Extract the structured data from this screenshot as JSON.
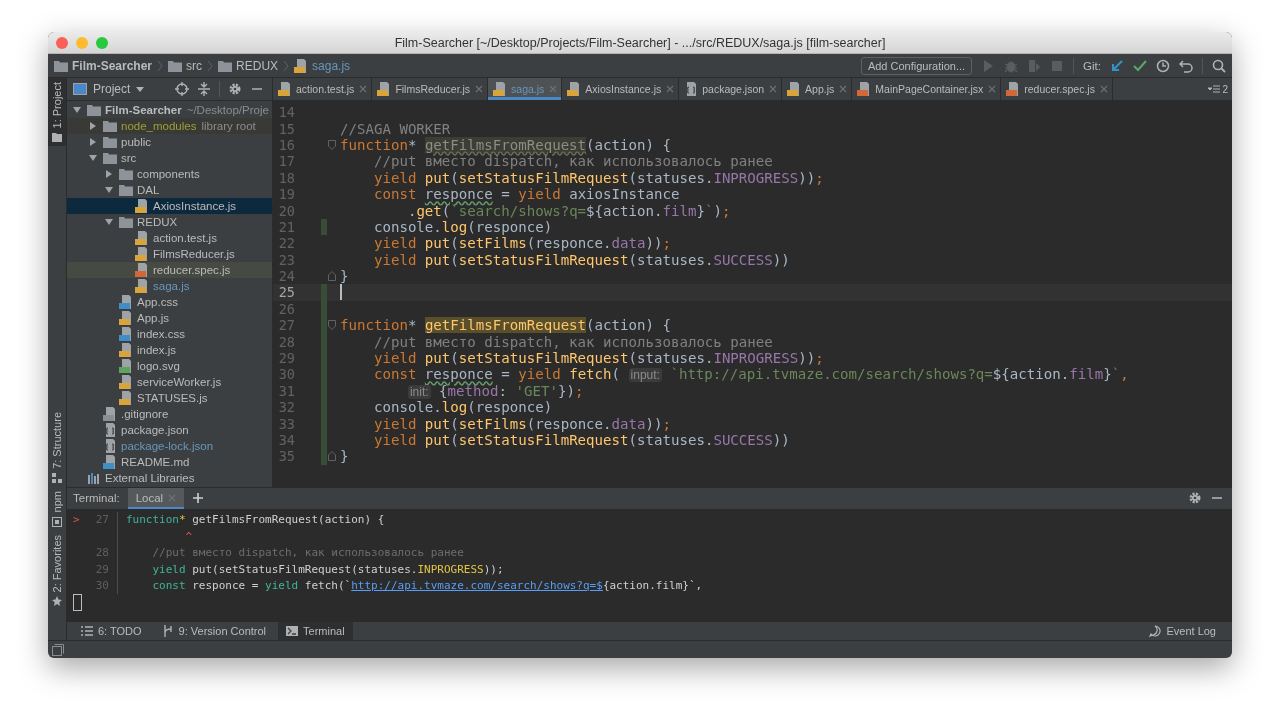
{
  "window": {
    "title": "Film-Searcher [~/Desktop/Projects/Film-Searcher] - .../src/REDUX/saga.js [film-searcher]"
  },
  "breadcrumbs": [
    {
      "label": "Film-Searcher",
      "kind": "folder",
      "bold": true,
      "modified": false
    },
    {
      "label": "src",
      "kind": "folder",
      "bold": false,
      "modified": false
    },
    {
      "label": "REDUX",
      "kind": "folder",
      "bold": false,
      "modified": false
    },
    {
      "label": "saga.js",
      "kind": "js",
      "bold": false,
      "modified": true
    }
  ],
  "toolbar": {
    "config_button": "Add Configuration...",
    "run_actions": [
      {
        "kind": "run",
        "disabled": true
      },
      {
        "kind": "debug",
        "disabled": true
      },
      {
        "kind": "coverage",
        "disabled": true
      },
      {
        "kind": "stop",
        "disabled": true
      }
    ],
    "git_label": "Git:",
    "git_actions": [
      {
        "kind": "update"
      },
      {
        "kind": "commit"
      },
      {
        "kind": "history"
      },
      {
        "kind": "revert"
      }
    ]
  },
  "left_strip": {
    "top": [
      {
        "label": "1: Project",
        "selected": true
      }
    ],
    "middle": [
      {
        "label": "7: Structure",
        "selected": false
      }
    ],
    "bottom": [
      {
        "label": "npm",
        "selected": false
      },
      {
        "label": "2: Favorites",
        "selected": false
      }
    ]
  },
  "project_panel": {
    "title": "Project",
    "tree": [
      {
        "label": "Film-Searcher",
        "suffix": "~/Desktop/Proje",
        "kind": "folder",
        "bold": true,
        "expanded": true,
        "selected": false,
        "children": [
          {
            "label": "node_modules",
            "suffix": "library root",
            "kind": "folder",
            "expanded": false,
            "selected": false,
            "excluded": true
          },
          {
            "label": "public",
            "kind": "folder",
            "expanded": false,
            "selected": false
          },
          {
            "label": "src",
            "kind": "folder",
            "expanded": true,
            "selected": false,
            "children": [
              {
                "label": "components",
                "kind": "folder",
                "expanded": false,
                "selected": false
              },
              {
                "label": "DAL",
                "kind": "folder",
                "expanded": true,
                "selected": false,
                "children": [
                  {
                    "label": "AxiosInstance.js",
                    "kind": "js",
                    "selected": true
                  }
                ]
              },
              {
                "label": "REDUX",
                "kind": "folder",
                "expanded": true,
                "selected": false,
                "children": [
                  {
                    "label": "action.test.js",
                    "kind": "js",
                    "selected": false
                  },
                  {
                    "label": "FilmsReducer.js",
                    "kind": "js",
                    "selected": false
                  },
                  {
                    "label": "reducer.spec.js",
                    "kind": "test",
                    "selected": false,
                    "highlighted": true
                  },
                  {
                    "label": "saga.js",
                    "kind": "js",
                    "selected": false,
                    "modified": true
                  }
                ]
              },
              {
                "label": "App.css",
                "kind": "css",
                "selected": false
              },
              {
                "label": "App.js",
                "kind": "js",
                "selected": false
              },
              {
                "label": "index.css",
                "kind": "css",
                "selected": false
              },
              {
                "label": "index.js",
                "kind": "js",
                "selected": false
              },
              {
                "label": "logo.svg",
                "kind": "svg",
                "selected": false
              },
              {
                "label": "serviceWorker.js",
                "kind": "js",
                "selected": false
              },
              {
                "label": "STATUSES.js",
                "kind": "js",
                "selected": false
              }
            ]
          },
          {
            "label": ".gitignore",
            "kind": "file",
            "selected": false
          },
          {
            "label": "package.json",
            "kind": "json",
            "selected": false
          },
          {
            "label": "package-lock.json",
            "kind": "json",
            "selected": false,
            "modified": true
          },
          {
            "label": "README.md",
            "kind": "md",
            "selected": false
          }
        ]
      },
      {
        "label": "External Libraries",
        "kind": "libraries",
        "selected": false
      }
    ]
  },
  "editor_tabs": [
    {
      "label": "action.test.js",
      "kind": "js",
      "selected": false,
      "modified": false
    },
    {
      "label": "FilmsReducer.js",
      "kind": "js",
      "selected": false,
      "modified": false
    },
    {
      "label": "saga.js",
      "kind": "js",
      "selected": true,
      "modified": true
    },
    {
      "label": "AxiosInstance.js",
      "kind": "js",
      "selected": false,
      "modified": false
    },
    {
      "label": "package.json",
      "kind": "json",
      "selected": false,
      "modified": false
    },
    {
      "label": "App.js",
      "kind": "js",
      "selected": false,
      "modified": false
    },
    {
      "label": "MainPageContainer.jsx",
      "kind": "jsx",
      "selected": false,
      "modified": false
    },
    {
      "label": "reducer.spec.js",
      "kind": "test",
      "selected": false,
      "modified": false
    }
  ],
  "tab_overflow_count": "2",
  "code_lines": [
    {
      "number": "14",
      "current": false,
      "changed": false
    },
    {
      "number": "15",
      "current": false,
      "changed": false,
      "tokens": [
        {
          "kind": "comment",
          "text": "//SAGA WORKER"
        }
      ]
    },
    {
      "number": "16",
      "current": false,
      "changed": false,
      "fold_start": true,
      "tokens": [
        {
          "kind": "kw",
          "text": "function"
        },
        {
          "kind": "plain",
          "text": "* "
        },
        {
          "kind": "unused",
          "text": "getFilmsFromRequest"
        },
        {
          "kind": "plain",
          "text": "(action) {"
        }
      ]
    },
    {
      "number": "17",
      "current": false,
      "changed": false,
      "tokens": [
        {
          "kind": "comment",
          "text": "    //put вместо dispatch, как использовалось ранее"
        }
      ]
    },
    {
      "number": "18",
      "current": false,
      "changed": false,
      "tokens": [
        {
          "kind": "kw",
          "text": "    yield"
        },
        {
          "kind": "fn",
          "text": " put"
        },
        {
          "kind": "plain",
          "text": "("
        },
        {
          "kind": "fn",
          "text": "setStatusFilmRequest"
        },
        {
          "kind": "plain",
          "text": "(statuses."
        },
        {
          "kind": "prop",
          "text": "INPROGRESS"
        },
        {
          "kind": "plain",
          "text": "))"
        },
        {
          "kind": "kw",
          "text": ";"
        }
      ]
    },
    {
      "number": "19",
      "current": false,
      "changed": false,
      "tokens": [
        {
          "kind": "kw",
          "text": "    const "
        },
        {
          "kind": "typo",
          "text": "responce"
        },
        {
          "kind": "plain",
          "text": " = "
        },
        {
          "kind": "kw",
          "text": "yield"
        },
        {
          "kind": "plain",
          "text": " axiosInstance"
        }
      ]
    },
    {
      "number": "20",
      "current": false,
      "changed": false,
      "tokens": [
        {
          "kind": "plain",
          "text": "        ."
        },
        {
          "kind": "fn",
          "text": "get"
        },
        {
          "kind": "plain",
          "text": "("
        },
        {
          "kind": "str",
          "text": "`search/shows?q="
        },
        {
          "kind": "plain",
          "text": "${action."
        },
        {
          "kind": "prop",
          "text": "film"
        },
        {
          "kind": "plain",
          "text": "}"
        },
        {
          "kind": "str",
          "text": "`"
        },
        {
          "kind": "plain",
          "text": ")"
        },
        {
          "kind": "kw",
          "text": ";"
        }
      ]
    },
    {
      "number": "21",
      "current": false,
      "changed": true,
      "tokens": [
        {
          "kind": "plain",
          "text": "    console."
        },
        {
          "kind": "fn",
          "text": "log"
        },
        {
          "kind": "plain",
          "text": "(responce)"
        }
      ]
    },
    {
      "number": "22",
      "current": false,
      "changed": false,
      "tokens": [
        {
          "kind": "kw",
          "text": "    yield"
        },
        {
          "kind": "fn",
          "text": " put"
        },
        {
          "kind": "plain",
          "text": "("
        },
        {
          "kind": "fn",
          "text": "setFilms"
        },
        {
          "kind": "plain",
          "text": "(responce."
        },
        {
          "kind": "prop",
          "text": "data"
        },
        {
          "kind": "plain",
          "text": "))"
        },
        {
          "kind": "kw",
          "text": ";"
        }
      ]
    },
    {
      "number": "23",
      "current": false,
      "changed": false,
      "tokens": [
        {
          "kind": "kw",
          "text": "    yield"
        },
        {
          "kind": "fn",
          "text": " put"
        },
        {
          "kind": "plain",
          "text": "("
        },
        {
          "kind": "fn",
          "text": "setStatusFilmRequest"
        },
        {
          "kind": "plain",
          "text": "(statuses."
        },
        {
          "kind": "prop",
          "text": "SUCCESS"
        },
        {
          "kind": "plain",
          "text": "))"
        }
      ]
    },
    {
      "number": "24",
      "current": false,
      "changed": false,
      "fold_end": true,
      "tokens": [
        {
          "kind": "plain",
          "text": "}"
        }
      ]
    },
    {
      "number": "25",
      "current": true,
      "changed": true
    },
    {
      "number": "26",
      "current": false,
      "changed": true
    },
    {
      "number": "27",
      "current": false,
      "changed": true,
      "fold_start": true,
      "tokens": [
        {
          "kind": "kw",
          "text": "function"
        },
        {
          "kind": "plain",
          "text": "* "
        },
        {
          "kind": "match",
          "text": "getFilmsFromRequest"
        },
        {
          "kind": "plain",
          "text": "(action) {"
        }
      ]
    },
    {
      "number": "28",
      "current": false,
      "changed": true,
      "tokens": [
        {
          "kind": "comment",
          "text": "    //put вместо dispatch, как использовалось ранее"
        }
      ]
    },
    {
      "number": "29",
      "current": false,
      "changed": true,
      "tokens": [
        {
          "kind": "kw",
          "text": "    yield"
        },
        {
          "kind": "fn",
          "text": " put"
        },
        {
          "kind": "plain",
          "text": "("
        },
        {
          "kind": "fn",
          "text": "setStatusFilmRequest"
        },
        {
          "kind": "plain",
          "text": "(statuses."
        },
        {
          "kind": "prop",
          "text": "INPROGRESS"
        },
        {
          "kind": "plain",
          "text": "))"
        },
        {
          "kind": "kw",
          "text": ";"
        }
      ]
    },
    {
      "number": "30",
      "current": false,
      "changed": true,
      "tokens": [
        {
          "kind": "kw",
          "text": "    const "
        },
        {
          "kind": "typo",
          "text": "responce"
        },
        {
          "kind": "plain",
          "text": " = "
        },
        {
          "kind": "kw",
          "text": "yield"
        },
        {
          "kind": "fn",
          "text": " fetch"
        },
        {
          "kind": "plain",
          "text": "( "
        },
        {
          "kind": "hint",
          "text": "input:"
        },
        {
          "kind": "str",
          "text": " `http://api.tvmaze.com/search/shows?q="
        },
        {
          "kind": "plain",
          "text": "${action."
        },
        {
          "kind": "prop",
          "text": "film"
        },
        {
          "kind": "plain",
          "text": "}"
        },
        {
          "kind": "str",
          "text": "`"
        },
        {
          "kind": "kw",
          "text": ","
        }
      ]
    },
    {
      "number": "31",
      "current": false,
      "changed": true,
      "continuation": true,
      "tokens": [
        {
          "kind": "hint",
          "text": "init:"
        },
        {
          "kind": "plain",
          "text": " {"
        },
        {
          "kind": "prop",
          "text": "method"
        },
        {
          "kind": "plain",
          "text": ": "
        },
        {
          "kind": "str",
          "text": "'GET'"
        },
        {
          "kind": "plain",
          "text": "})"
        },
        {
          "kind": "kw",
          "text": ";"
        }
      ]
    },
    {
      "number": "32",
      "current": false,
      "changed": true,
      "tokens": [
        {
          "kind": "plain",
          "text": "    console."
        },
        {
          "kind": "fn",
          "text": "log"
        },
        {
          "kind": "plain",
          "text": "(responce)"
        }
      ]
    },
    {
      "number": "33",
      "current": false,
      "changed": true,
      "tokens": [
        {
          "kind": "kw",
          "text": "    yield"
        },
        {
          "kind": "fn",
          "text": " put"
        },
        {
          "kind": "plain",
          "text": "("
        },
        {
          "kind": "fn",
          "text": "setFilms"
        },
        {
          "kind": "plain",
          "text": "(responce."
        },
        {
          "kind": "prop",
          "text": "data"
        },
        {
          "kind": "plain",
          "text": "))"
        },
        {
          "kind": "kw",
          "text": ";"
        }
      ]
    },
    {
      "number": "34",
      "current": false,
      "changed": true,
      "tokens": [
        {
          "kind": "kw",
          "text": "    yield"
        },
        {
          "kind": "fn",
          "text": " put"
        },
        {
          "kind": "plain",
          "text": "("
        },
        {
          "kind": "fn",
          "text": "setStatusFilmRequest"
        },
        {
          "kind": "plain",
          "text": "(statuses."
        },
        {
          "kind": "prop",
          "text": "SUCCESS"
        },
        {
          "kind": "plain",
          "text": "))"
        }
      ]
    },
    {
      "number": "35",
      "current": false,
      "changed": true,
      "fold_end": true,
      "tokens": [
        {
          "kind": "plain",
          "text": "}"
        }
      ]
    }
  ],
  "terminal": {
    "title": "Terminal:",
    "tabs": [
      {
        "label": "Local",
        "selected": true
      }
    ],
    "lines": [
      {
        "marker": ">",
        "number": "27",
        "tokens": [
          {
            "kind": "kw",
            "text": "function"
          },
          {
            "kind": "star",
            "text": "*"
          },
          {
            "kind": "plain",
            "text": " getFilmsFromRequest(action) {"
          }
        ]
      },
      {
        "tokens": [
          {
            "kind": "error",
            "text": "         ^"
          }
        ]
      },
      {
        "number": "28",
        "tokens": [
          {
            "kind": "comment",
            "text": "    //put вместо dispatch, как использовалось ранее"
          }
        ]
      },
      {
        "number": "29",
        "tokens": [
          {
            "kind": "kw",
            "text": "    yield"
          },
          {
            "kind": "plain",
            "text": " put(setStatusFilmRequest(statuses."
          },
          {
            "kind": "const",
            "text": "INPROGRESS"
          },
          {
            "kind": "plain",
            "text": "));"
          }
        ]
      },
      {
        "number": "30",
        "tokens": [
          {
            "kind": "kw",
            "text": "    const"
          },
          {
            "kind": "plain",
            "text": " responce = "
          },
          {
            "kind": "kw",
            "text": "yield"
          },
          {
            "kind": "plain",
            "text": " fetch(`"
          },
          {
            "kind": "link",
            "text": "http://api.tvmaze.com/search/shows?q=$"
          },
          {
            "kind": "plain",
            "text": "{action.film}`,"
          }
        ]
      }
    ]
  },
  "bottom_tools": [
    {
      "label": "6: TODO",
      "kind": "todo",
      "selected": false
    },
    {
      "label": "9: Version Control",
      "kind": "vcs",
      "selected": false
    },
    {
      "label": "Terminal",
      "kind": "terminal",
      "selected": true
    }
  ],
  "event_log": "Event Log"
}
